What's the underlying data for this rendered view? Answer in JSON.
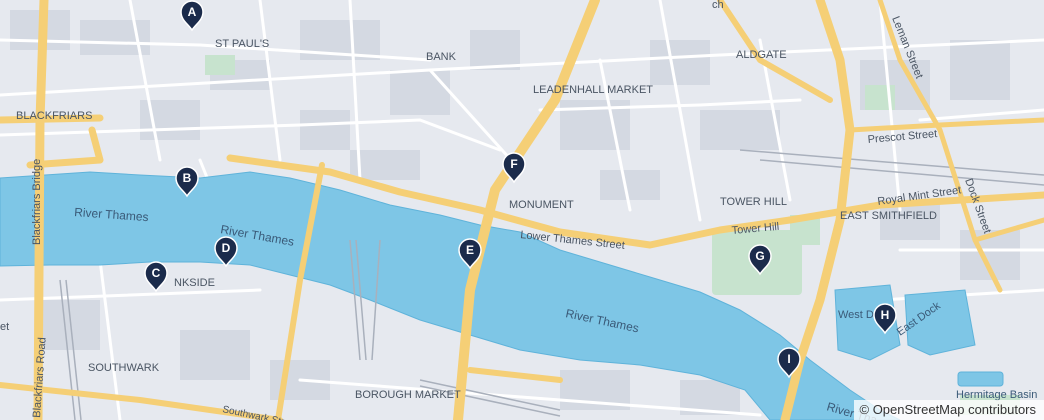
{
  "map": {
    "attribution": "© OpenStreetMap contributors",
    "colors": {
      "land": "#e6e9ef",
      "block": "#d3d8e1",
      "river": "#7ec6e6",
      "river_edge": "#5fb3da",
      "major_road": "#f6d37a",
      "street": "#ffffff",
      "park": "#c8e4cf",
      "marker": "#1b2b4b",
      "label": "#4a5563",
      "water_label": "#3a5a78"
    },
    "labels": {
      "st_pauls": "ST PAUL'S",
      "bank": "BANK",
      "aldgate": "ALDGATE",
      "leadenhall_market": "LEADENHALL MARKET",
      "blackfriars": "BLACKFRIARS",
      "blackfriars_bridge": "Blackfriars Bridge",
      "monument": "MONUMENT",
      "tower_hill": "TOWER HILL",
      "east_smithfield": "EAST SMITHFIELD",
      "lower_thames_street": "Lower Thames Street",
      "tower_hill_street": "Tower Hill",
      "royal_mint_street": "Royal Mint Street",
      "prescot_street": "Prescot Street",
      "leman_street": "Leman Street",
      "dock_street": "Dock Street",
      "river_thames_1": "River Thames",
      "river_thames_2": "River Thames",
      "river_thames_3": "River Thames",
      "river_thames_4": "River Tha",
      "bankside": "NKSIDE",
      "southwark": "SOUTHWARK",
      "borough_market": "BOROUGH MARKET",
      "blackfriars_road": "Blackfriars Road",
      "southwark_street": "Southwark Street",
      "west_dock": "West Dock",
      "east_dock": "East Dock",
      "hermitage_basin": "Hermitage Basin",
      "edge_et": "et",
      "edge_ch": "ch"
    },
    "markers": [
      {
        "id": "A"
      },
      {
        "id": "B"
      },
      {
        "id": "C"
      },
      {
        "id": "D"
      },
      {
        "id": "E"
      },
      {
        "id": "F"
      },
      {
        "id": "G"
      },
      {
        "id": "H"
      },
      {
        "id": "I"
      }
    ]
  }
}
